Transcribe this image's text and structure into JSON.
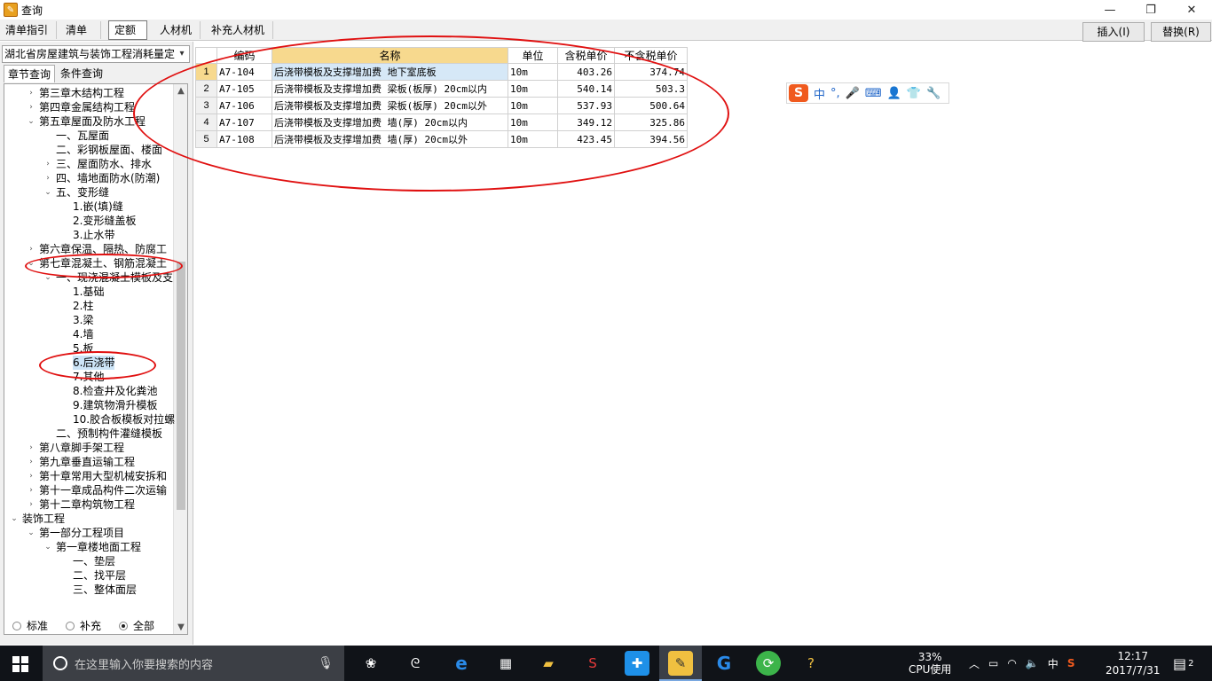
{
  "window": {
    "title": "查询",
    "min": "—",
    "max": "❐",
    "close": "✕"
  },
  "tabs": [
    {
      "label": "清单指引"
    },
    {
      "label": "清单"
    },
    {
      "label": "定额"
    },
    {
      "label": "人材机"
    },
    {
      "label": "补充人材机"
    }
  ],
  "actions": {
    "insert": "插入(I)",
    "replace": "替换(R)"
  },
  "left": {
    "library": "湖北省房屋建筑与装饰工程消耗量定",
    "subtabs": [
      "章节查询",
      "条件查询"
    ],
    "tree": [
      {
        "label": "第三章木结构工程",
        "toggle": "›"
      },
      {
        "label": "第四章金属结构工程",
        "toggle": "›"
      },
      {
        "label": "第五章屋面及防水工程",
        "toggle": "⌄"
      },
      {
        "label": "一、瓦屋面",
        "toggle": ""
      },
      {
        "label": "二、彩钢板屋面、楼面",
        "toggle": ""
      },
      {
        "label": "三、屋面防水、排水",
        "toggle": "›"
      },
      {
        "label": "四、墙地面防水(防潮)",
        "toggle": "›"
      },
      {
        "label": "五、变形缝",
        "toggle": "⌄"
      },
      {
        "label": "1.嵌(填)缝",
        "toggle": ""
      },
      {
        "label": "2.变形缝盖板",
        "toggle": ""
      },
      {
        "label": "3.止水带",
        "toggle": ""
      },
      {
        "label": "第六章保温、隔热、防腐工",
        "toggle": "›"
      },
      {
        "label": "第七章混凝土、钢筋混凝土",
        "toggle": "⌄"
      },
      {
        "label": "一、现浇混凝土模板及支",
        "toggle": "⌄"
      },
      {
        "label": "1.基础",
        "toggle": ""
      },
      {
        "label": "2.柱",
        "toggle": ""
      },
      {
        "label": "3.梁",
        "toggle": ""
      },
      {
        "label": "4.墙",
        "toggle": ""
      },
      {
        "label": "5.板",
        "toggle": ""
      },
      {
        "label": "6.后浇带",
        "toggle": ""
      },
      {
        "label": "7.其他",
        "toggle": ""
      },
      {
        "label": "8.检查井及化粪池",
        "toggle": ""
      },
      {
        "label": "9.建筑物滑升模板",
        "toggle": ""
      },
      {
        "label": "10.胶合板模板对拉螺",
        "toggle": ""
      },
      {
        "label": "二、预制构件灌缝模板",
        "toggle": ""
      },
      {
        "label": "第八章脚手架工程",
        "toggle": "›"
      },
      {
        "label": "第九章垂直运输工程",
        "toggle": "›"
      },
      {
        "label": "第十章常用大型机械安拆和",
        "toggle": "›"
      },
      {
        "label": "第十一章成品构件二次运输",
        "toggle": "›"
      },
      {
        "label": "第十二章构筑物工程",
        "toggle": "›"
      },
      {
        "label": "装饰工程",
        "toggle": "⌄"
      },
      {
        "label": "第一部分工程项目",
        "toggle": "⌄"
      },
      {
        "label": "第一章楼地面工程",
        "toggle": "⌄"
      },
      {
        "label": "一、垫层",
        "toggle": ""
      },
      {
        "label": "二、找平层",
        "toggle": ""
      },
      {
        "label": "三、整体面层",
        "toggle": ""
      }
    ],
    "radios": [
      {
        "label": "标准",
        "checked": false
      },
      {
        "label": "补充",
        "checked": false
      },
      {
        "label": "全部",
        "checked": true
      }
    ]
  },
  "grid": {
    "headers": [
      "编码",
      "名称",
      "单位",
      "含税单价",
      "不含税单价"
    ],
    "rows": [
      {
        "n": "1",
        "code": "A7-104",
        "name": "后浇带模板及支撑增加费 地下室底板",
        "unit": "10m",
        "tax": "403.26",
        "notax": "374.74"
      },
      {
        "n": "2",
        "code": "A7-105",
        "name": "后浇带模板及支撑增加费 梁板(板厚) 20cm以内",
        "unit": "10m",
        "tax": "540.14",
        "notax": "503.3"
      },
      {
        "n": "3",
        "code": "A7-106",
        "name": "后浇带模板及支撑增加费 梁板(板厚) 20cm以外",
        "unit": "10m",
        "tax": "537.93",
        "notax": "500.64"
      },
      {
        "n": "4",
        "code": "A7-107",
        "name": "后浇带模板及支撑增加费 墙(厚) 20cm以内",
        "unit": "10m",
        "tax": "349.12",
        "notax": "325.86"
      },
      {
        "n": "5",
        "code": "A7-108",
        "name": "后浇带模板及支撑增加费 墙(厚) 20cm以外",
        "unit": "10m",
        "tax": "423.45",
        "notax": "394.56"
      }
    ]
  },
  "ime": {
    "logo": "S",
    "mode": "中",
    "punct": "°,"
  },
  "taskbar": {
    "search_placeholder": "在这里输入你要搜索的内容",
    "cpu_percent": "33%",
    "cpu_label": "CPU使用",
    "ime_lang": "中",
    "time": "12:17",
    "date": "2017/7/31",
    "notifications": "2"
  },
  "colors": {
    "header_highlight": "#f7d98e",
    "selection": "#cce4f7",
    "annotation": "#e01010",
    "taskbar": "#101318"
  }
}
